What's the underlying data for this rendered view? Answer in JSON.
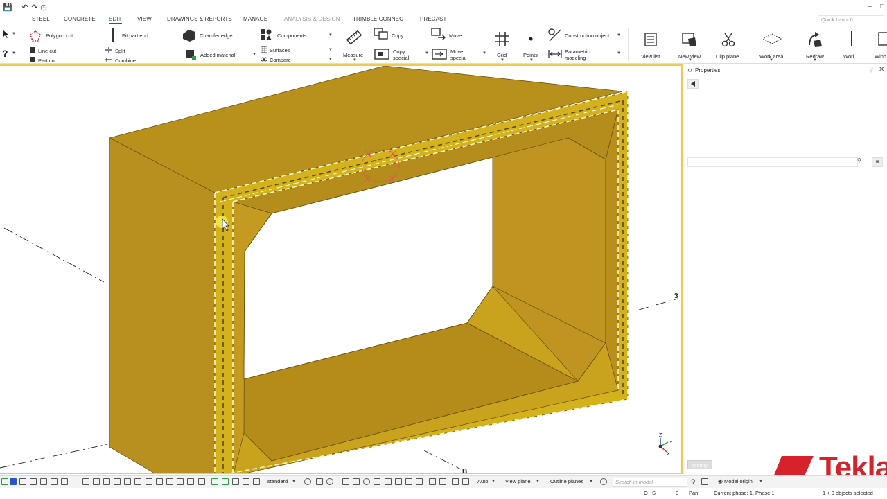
{
  "menu": {
    "tabs": [
      {
        "label": "STEEL"
      },
      {
        "label": "CONCRETE"
      },
      {
        "label": "EDIT"
      },
      {
        "label": "VIEW"
      },
      {
        "label": "DRAWINGS & REPORTS"
      },
      {
        "label": "MANAGE"
      },
      {
        "label": "ANALYSIS & DESIGN"
      },
      {
        "label": "TRIMBLE CONNECT"
      },
      {
        "label": "PRECAST"
      }
    ],
    "active_tab": "EDIT",
    "quick_launch_placeholder": "Quick Launch"
  },
  "ribbon": {
    "polygon_cut": "Polygon cut",
    "line_cut": "Line cut",
    "part_cut": "Part cut",
    "fit_part_end": "Fit part end",
    "split": "Split",
    "combine": "Combine",
    "chamfer_edge": "Chamfer edge",
    "added_material": "Added material",
    "components": "Components",
    "surfaces": "Surfaces",
    "compare": "Compare",
    "measure": "Measure",
    "copy": "Copy",
    "copy_special_1": "Copy",
    "copy_special_2": "special",
    "move": "Move",
    "move_special_1": "Move",
    "move_special_2": "special",
    "grid": "Grid",
    "points": "Points",
    "construction_object": "Construction object",
    "parametric_1": "Parametric",
    "parametric_2": "modeling",
    "view_list": "View list",
    "new_view": "New view",
    "clip_plane": "Clip plane",
    "work_area": "Work area",
    "redraw": "Redraw",
    "work_cut": "Worl",
    "window_cut": "Wind"
  },
  "viewport": {
    "grid_label_3": "3",
    "grid_label_b": "B",
    "axis_z": "Z",
    "axis_y": "Y",
    "axis_x": "X",
    "accent_color": "#f2c94c",
    "part_color": "#c59a1e"
  },
  "properties": {
    "title": "Properties",
    "modify_label": "Modify"
  },
  "bottombar": {
    "standard": "standard",
    "auto": "Auto",
    "view_plane": "View plane",
    "outline_planes": "Outline planes",
    "search_placeholder": "Search in model",
    "model_origin": "Model origin"
  },
  "status": {
    "o": "O",
    "s": "S",
    "zero": "0",
    "pan": "Pan",
    "current_phase": "Current phase: 1, Phase 1",
    "selected": "1 + 0 objects selected"
  },
  "brand": {
    "name": "Tekla",
    "color": "#d6232b"
  }
}
